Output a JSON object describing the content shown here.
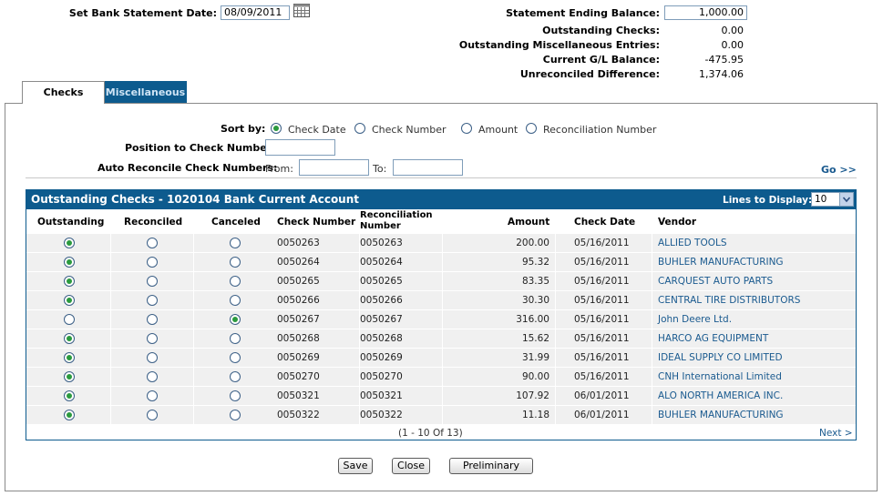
{
  "header": {
    "set_date_label": "Set Bank Statement Date:",
    "set_date_value": "08/09/2011",
    "ending_balance_label": "Statement Ending Balance:",
    "ending_balance_value": "1,000.00",
    "summary": [
      {
        "label": "Outstanding Checks:",
        "value": "0.00"
      },
      {
        "label": "Outstanding Miscellaneous Entries:",
        "value": "0.00"
      },
      {
        "label": "Current G/L Balance:",
        "value": "-475.95"
      },
      {
        "label": "Unreconciled Difference:",
        "value": "1,374.06"
      }
    ]
  },
  "tabs": [
    {
      "label": "Checks",
      "active": true
    },
    {
      "label": "Miscellaneous",
      "active": false
    }
  ],
  "filters": {
    "sort_by_label": "Sort by:",
    "sort_options": [
      "Check Date",
      "Check Number",
      "Amount",
      "Reconciliation Number"
    ],
    "sort_selected": "Check Date",
    "position_label": "Position to Check Number:",
    "position_value": "",
    "auto_label": "Auto Reconcile Check Numbers:",
    "from_label": "From:",
    "from_value": "",
    "to_label": "To:",
    "to_value": "",
    "go_label": "Go >>"
  },
  "grid": {
    "title": "Outstanding Checks - 1020104 Bank Current Account",
    "lines_label": "Lines to Display:",
    "lines_value": "10",
    "columns": [
      "Outstanding",
      "Reconciled",
      "Canceled",
      "Check Number",
      "Reconciliation Number",
      "Amount",
      "Check Date",
      "Vendor"
    ],
    "rows": [
      {
        "status": "outstanding",
        "check": "0050263",
        "recon": "0050263",
        "amount": "200.00",
        "date": "05/16/2011",
        "vendor": "ALLIED TOOLS"
      },
      {
        "status": "outstanding",
        "check": "0050264",
        "recon": "0050264",
        "amount": "95.32",
        "date": "05/16/2011",
        "vendor": "BUHLER MANUFACTURING"
      },
      {
        "status": "outstanding",
        "check": "0050265",
        "recon": "0050265",
        "amount": "83.35",
        "date": "05/16/2011",
        "vendor": "CARQUEST AUTO PARTS"
      },
      {
        "status": "outstanding",
        "check": "0050266",
        "recon": "0050266",
        "amount": "30.30",
        "date": "05/16/2011",
        "vendor": "CENTRAL TIRE DISTRIBUTORS"
      },
      {
        "status": "canceled",
        "check": "0050267",
        "recon": "0050267",
        "amount": "316.00",
        "date": "05/16/2011",
        "vendor": "John Deere Ltd."
      },
      {
        "status": "outstanding",
        "check": "0050268",
        "recon": "0050268",
        "amount": "15.62",
        "date": "05/16/2011",
        "vendor": "HARCO AG EQUIPMENT"
      },
      {
        "status": "outstanding",
        "check": "0050269",
        "recon": "0050269",
        "amount": "31.99",
        "date": "05/16/2011",
        "vendor": "IDEAL SUPPLY CO LIMITED"
      },
      {
        "status": "outstanding",
        "check": "0050270",
        "recon": "0050270",
        "amount": "90.00",
        "date": "05/16/2011",
        "vendor": "CNH International Limited"
      },
      {
        "status": "outstanding",
        "check": "0050321",
        "recon": "0050321",
        "amount": "107.92",
        "date": "06/01/2011",
        "vendor": "ALO NORTH AMERICA INC."
      },
      {
        "status": "outstanding",
        "check": "0050322",
        "recon": "0050322",
        "amount": "11.18",
        "date": "06/01/2011",
        "vendor": "BUHLER MANUFACTURING"
      }
    ],
    "pager_text": "(1 - 10 Of 13)",
    "next_label": "Next >"
  },
  "buttons": {
    "save": "Save",
    "close": "Close",
    "preliminary": "Preliminary"
  }
}
